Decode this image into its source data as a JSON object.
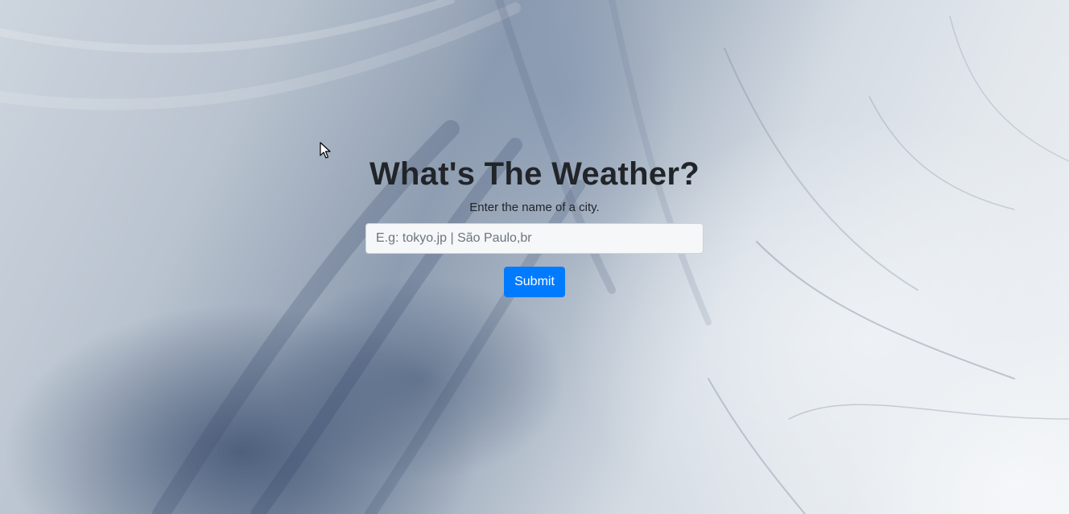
{
  "page": {
    "title": "What's The Weather?",
    "subtitle": "Enter the name of a city."
  },
  "form": {
    "city_placeholder": "E.g: tokyo.jp | São Paulo,br",
    "city_value": "",
    "submit_label": "Submit"
  },
  "colors": {
    "accent": "#007bff",
    "text": "#212529",
    "input_bg": "#f5f7f9"
  },
  "icons": {
    "pointer": "mouse-pointer-icon"
  }
}
